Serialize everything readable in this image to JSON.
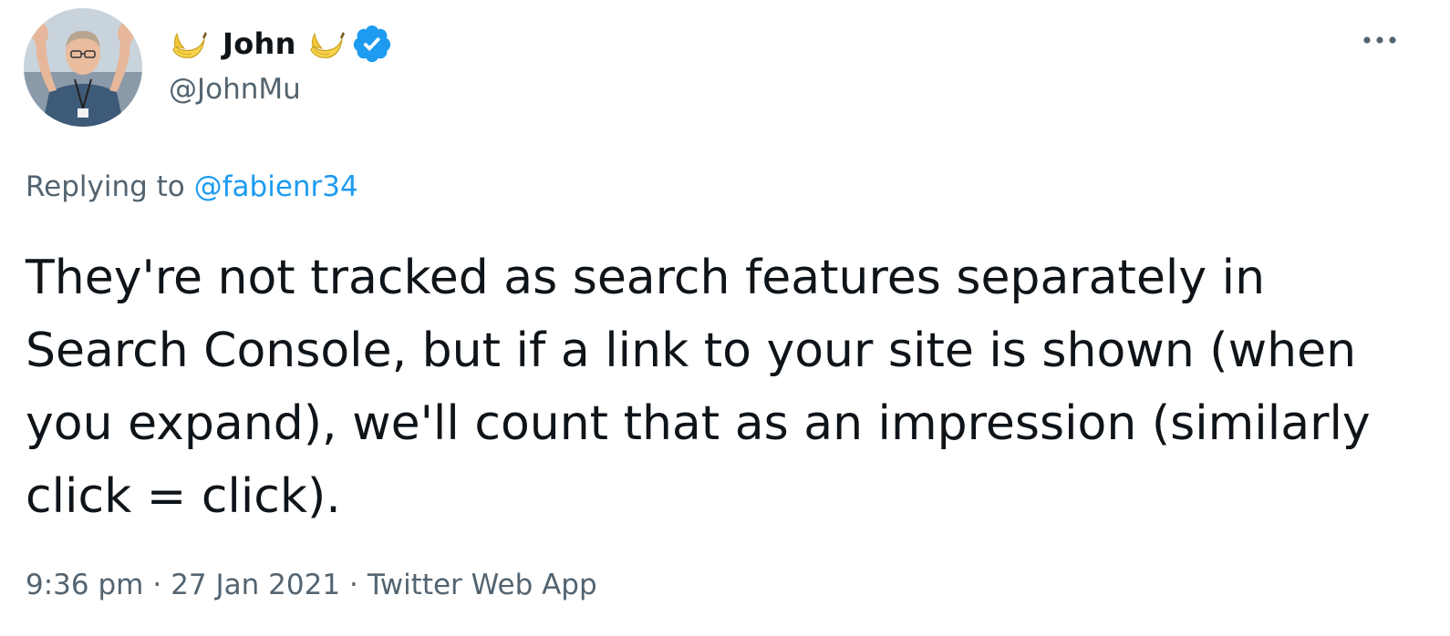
{
  "author": {
    "display_name": "John",
    "handle": "@JohnMu",
    "name_emoji": "banana-icon",
    "verified": true
  },
  "reply": {
    "prefix": "Replying to",
    "mention": "@fabienr34"
  },
  "tweet": {
    "text": "They're not tracked as search features separately in Search Console, but if a link to your site is shown (when you expand), we'll count that as an impression (similarly click = click)."
  },
  "meta": {
    "time": "9:36 pm",
    "date": "27 Jan 2021",
    "separator": "·",
    "source": "Twitter Web App"
  },
  "colors": {
    "text": "#0f1419",
    "secondary": "#536471",
    "accent": "#1d9bf0"
  },
  "icons": {
    "more": "more-horizontal-icon",
    "verified": "verified-badge-icon"
  }
}
